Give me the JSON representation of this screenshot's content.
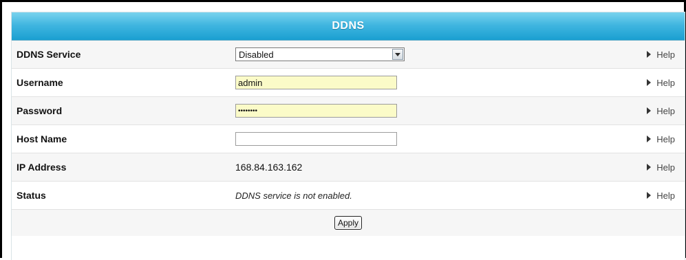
{
  "panel": {
    "title": "DDNS"
  },
  "rows": [
    {
      "label": "DDNS Service",
      "help": "Help"
    },
    {
      "label": "Username",
      "help": "Help"
    },
    {
      "label": "Password",
      "help": "Help"
    },
    {
      "label": "Host Name",
      "help": "Help"
    },
    {
      "label": "IP Address",
      "help": "Help"
    },
    {
      "label": "Status",
      "help": "Help"
    }
  ],
  "ddns_service": {
    "selected": "Disabled"
  },
  "username": {
    "value": "admin"
  },
  "password": {
    "value": "••••••••"
  },
  "host_name": {
    "value": ""
  },
  "ip_address": {
    "value": "168.84.163.162"
  },
  "status": {
    "value": "DDNS service is not enabled."
  },
  "actions": {
    "apply_label": "Apply"
  },
  "colors": {
    "header": "#41b6e0",
    "filled_input": "#fbfbc8",
    "alt_row": "#f6f6f6"
  },
  "icons": {
    "help": "triangle-right-icon",
    "select": "chevron-down-icon"
  }
}
